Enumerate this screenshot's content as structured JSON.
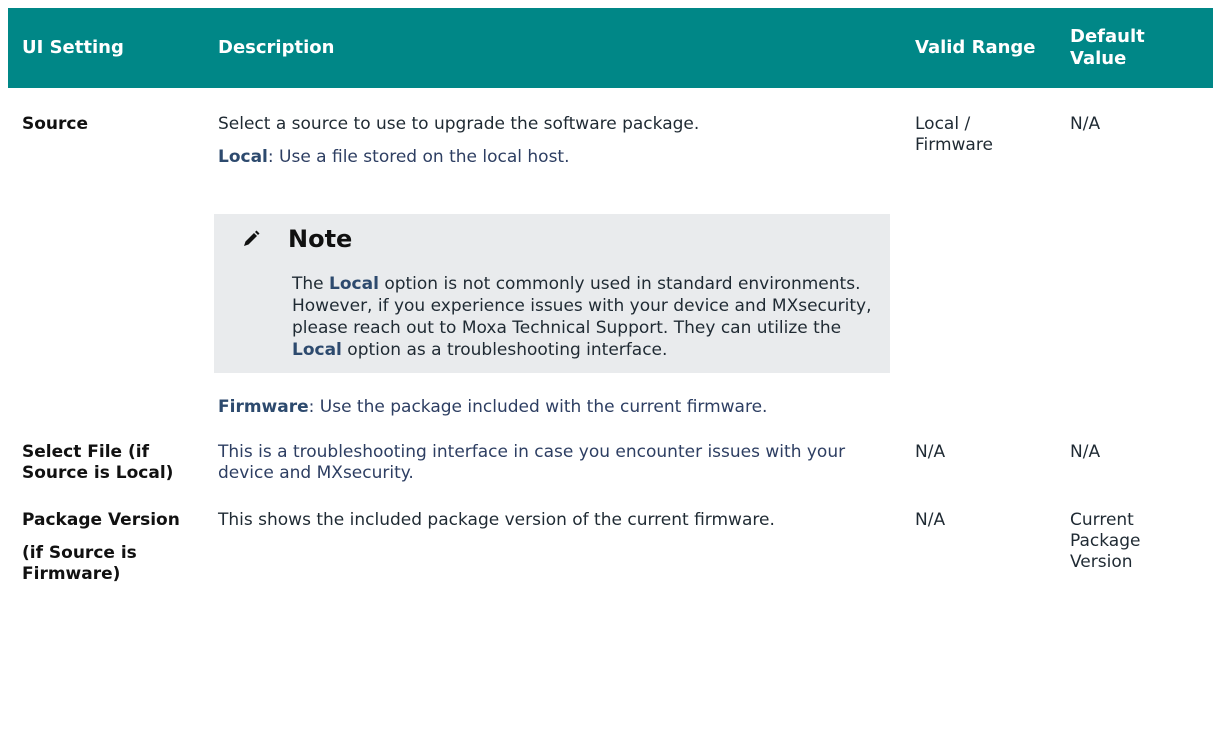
{
  "table": {
    "headers": {
      "ui_setting": "UI Setting",
      "description": "Description",
      "valid_range": "Valid Range",
      "default_value": "Default Value"
    },
    "rows": [
      {
        "setting": "Source",
        "description_intro": "Select a source to use to upgrade the software package.",
        "local_label": "Local",
        "local_text": ": Use a file stored on the local host.",
        "note": {
          "title": "Note",
          "text_1": "The ",
          "bold_1": "Local",
          "text_2": " option is not commonly used in standard environments. However, if you experience issues with your device and MXsecurity, please reach out to Moxa Technical Support. They can utilize the ",
          "bold_2": "Local",
          "text_3": " option as a troubleshooting interface."
        },
        "firmware_label": "Firmware",
        "firmware_text": ": Use the package included with the current firmware.",
        "valid_range": "Local / Firmware",
        "default_value": "N/A"
      },
      {
        "setting": "Select File (if Source is Local)",
        "description": "This is a troubleshooting interface in case you encounter issues with your device and MXsecurity.",
        "valid_range": "N/A",
        "default_value": "N/A"
      },
      {
        "setting": "Package Version",
        "setting_sub": "(if Source is Firmware)",
        "description": "This shows the included package version of the current firmware.",
        "valid_range": "N/A",
        "default_value": "Current Package Version"
      }
    ]
  }
}
